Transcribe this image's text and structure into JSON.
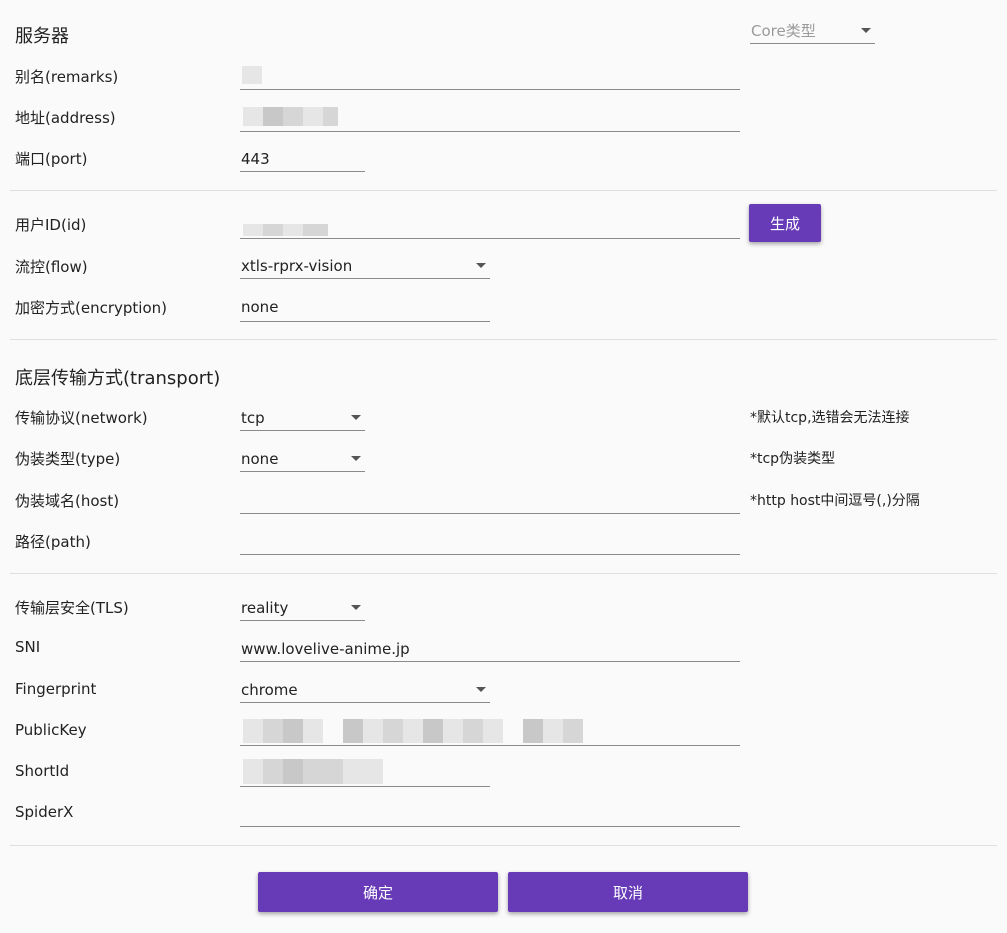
{
  "server": {
    "title": "服务器",
    "core_type_placeholder": "Core类型",
    "remarks_label": "别名(remarks)",
    "address_label": "地址(address)",
    "port_label": "端口(port)",
    "port_value": "443"
  },
  "user": {
    "id_label": "用户ID(id)",
    "generate_button": "生成",
    "flow_label": "流控(flow)",
    "flow_value": "xtls-rprx-vision",
    "encryption_label": "加密方式(encryption)",
    "encryption_value": "none"
  },
  "transport": {
    "title": "底层传输方式(transport)",
    "network_label": "传输协议(network)",
    "network_value": "tcp",
    "network_hint": "*默认tcp,选错会无法连接",
    "type_label": "伪装类型(type)",
    "type_value": "none",
    "type_hint": "*tcp伪装类型",
    "host_label": "伪装域名(host)",
    "host_hint": "*http host中间逗号(,)分隔",
    "path_label": "路径(path)"
  },
  "tls": {
    "security_label": "传输层安全(TLS)",
    "security_value": "reality",
    "sni_label": "SNI",
    "sni_value": "www.lovelive-anime.jp",
    "fingerprint_label": "Fingerprint",
    "fingerprint_value": "chrome",
    "publickey_label": "PublicKey",
    "shortid_label": "ShortId",
    "spiderx_label": "SpiderX"
  },
  "actions": {
    "ok_button": "确定",
    "cancel_button": "取消"
  },
  "colors": {
    "accent": "#673ab7",
    "background": "#fafafa",
    "divider": "#e0e0e0"
  }
}
